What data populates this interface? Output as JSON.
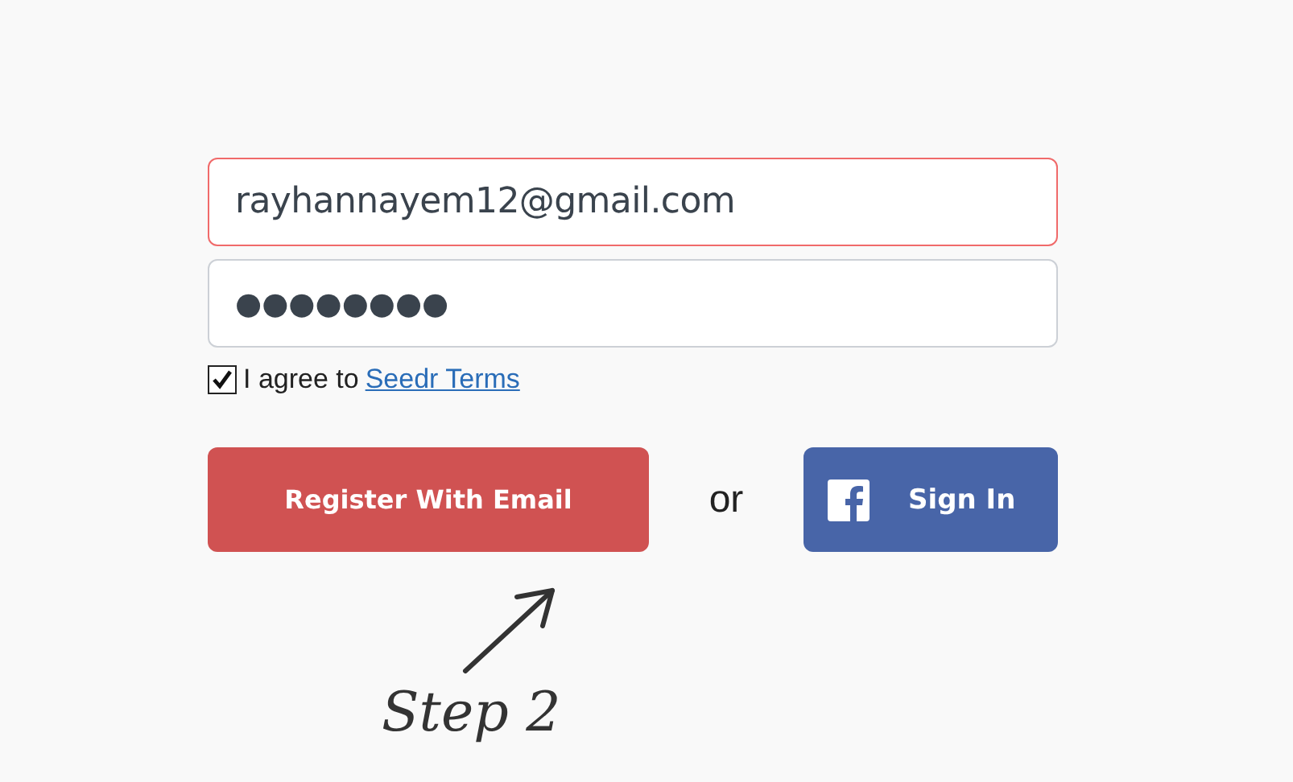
{
  "email_field": {
    "value": "rayhannayem12@gmail.com",
    "invalid": true
  },
  "password_field": {
    "value": "●●●●●●●●",
    "invalid": false
  },
  "agree": {
    "label": "I agree to",
    "link": "Seedr Terms",
    "checked": true
  },
  "register_button": {
    "label": "Register With Email"
  },
  "separator": "or",
  "facebook_button": {
    "label": "Sign In"
  },
  "annotation": {
    "text": "Step 2"
  }
}
